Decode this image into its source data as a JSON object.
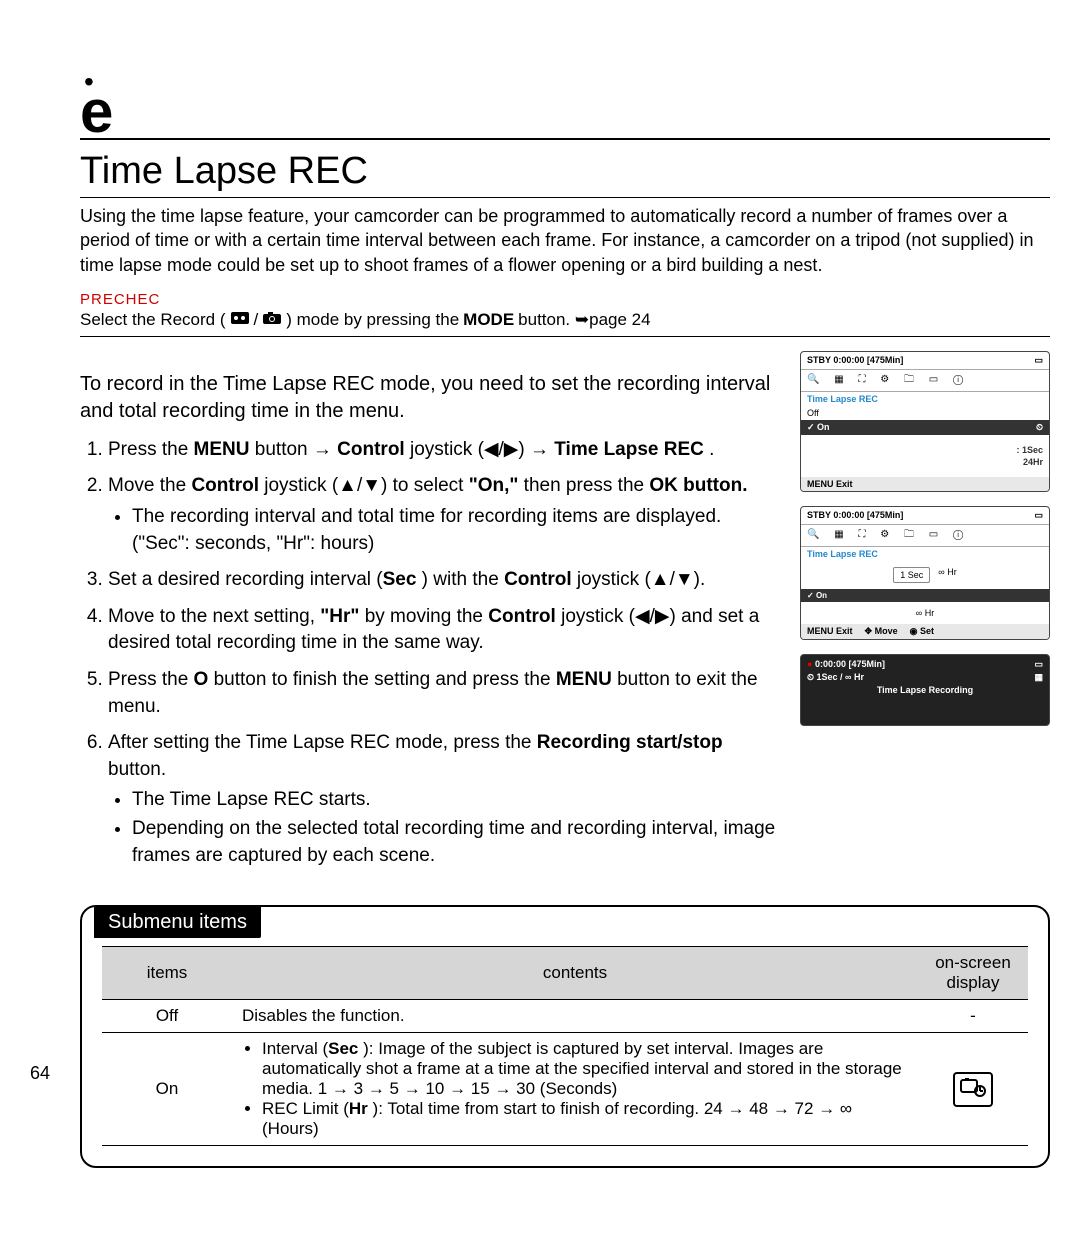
{
  "header_glyph": "e",
  "title": "Time Lapse REC",
  "intro": "Using the time lapse feature, your camcorder can be programmed to automatically record a number of frames over a period of time or with a certain time interval between each frame. For instance, a camcorder on a tripod (not supplied) in time lapse mode could be set up to shoot frames of a flower opening or a bird building a nest.",
  "prechec": "PRECHEC",
  "mode_line_prefix": "Select the Record (",
  "mode_line_mid": " / ",
  "mode_line_suffix": ") mode by pressing the ",
  "mode_button": "MODE",
  "mode_line_end": " button. ➥page 24",
  "lead": "To record in the Time Lapse REC mode, you need to set the recording interval and total recording time in the menu.",
  "steps": {
    "s1a": "Press the ",
    "s1_menu": "MENU",
    "s1b": " button → ",
    "s1_control": "Control",
    "s1c": " joystick (◀/▶) → ",
    "s1_tlr": "Time Lapse REC",
    "s1d": " .",
    "s2a": "Move the ",
    "s2_control": "Control",
    "s2b": " joystick (▲/▼) to select ",
    "s2_on": "\"On,\"",
    "s2c": " then press the ",
    "s2_ok": "OK button.",
    "s2_bullet": "The recording interval and total time for recording items are displayed. (\"Sec\": seconds, \"Hr\": hours)",
    "s3a": "Set a desired recording interval (",
    "s3_sec": "Sec",
    "s3b": " ) with the ",
    "s3_control": "Control",
    "s3c": " joystick (▲/▼).",
    "s4a": "Move to the next setting, ",
    "s4_hr": "\"Hr\"",
    "s4b": " by moving the ",
    "s4_control": "Control",
    "s4c": " joystick (◀/▶) and set a desired total recording time in the same way.",
    "s5a": "Press the ",
    "s5_ok": "O",
    "s5b": "  button to finish the setting and press the ",
    "s5_menu": "MENU",
    "s5c": " button to exit the menu.",
    "s6a": "After setting the Time Lapse REC mode, press the ",
    "s6_rec": "Recording start/stop",
    "s6b": " button.",
    "s6_bullet1": "The Time Lapse REC starts.",
    "s6_bullet2": "Depending on the selected total recording time and recording interval, image frames are captured by each scene."
  },
  "shots": {
    "stby": "STBY",
    "time": "0:00:00",
    "remain": "[475Min]",
    "tlr": "Time Lapse REC",
    "off": "Off",
    "on": "On",
    "sec_val": ": 1Sec",
    "hr_val": "24Hr",
    "menu": "MENU",
    "exit": "Exit",
    "move": "Move",
    "set": "Set",
    "sec": "Sec",
    "hr": "Hr",
    "interval_line": "1Sec / ∞ Hr",
    "rec_line": "Time Lapse Recording"
  },
  "submenu": {
    "title": "Submenu items",
    "col1": "items",
    "col2": "contents",
    "col3": "on-screen display",
    "row_off_item": "Off",
    "row_off_content": "Disables the function.",
    "row_off_osd": "-",
    "row_on_item": "On",
    "row_on_b1a": "Interval (",
    "row_on_b1_sec": "Sec",
    "row_on_b1b": " ): Image of the subject is captured by set interval. Images are automatically shot a frame at a time at the specified interval and stored in the storage media. 1 → 3 → 5 → 10 → 15 → 30 (Seconds)",
    "row_on_b2a": "REC Limit (",
    "row_on_b2_hr": "Hr",
    "row_on_b2b": " ): Total time from start to finish of recording. 24 → 48 → 72 → ∞ (Hours)"
  },
  "page_num": "64"
}
